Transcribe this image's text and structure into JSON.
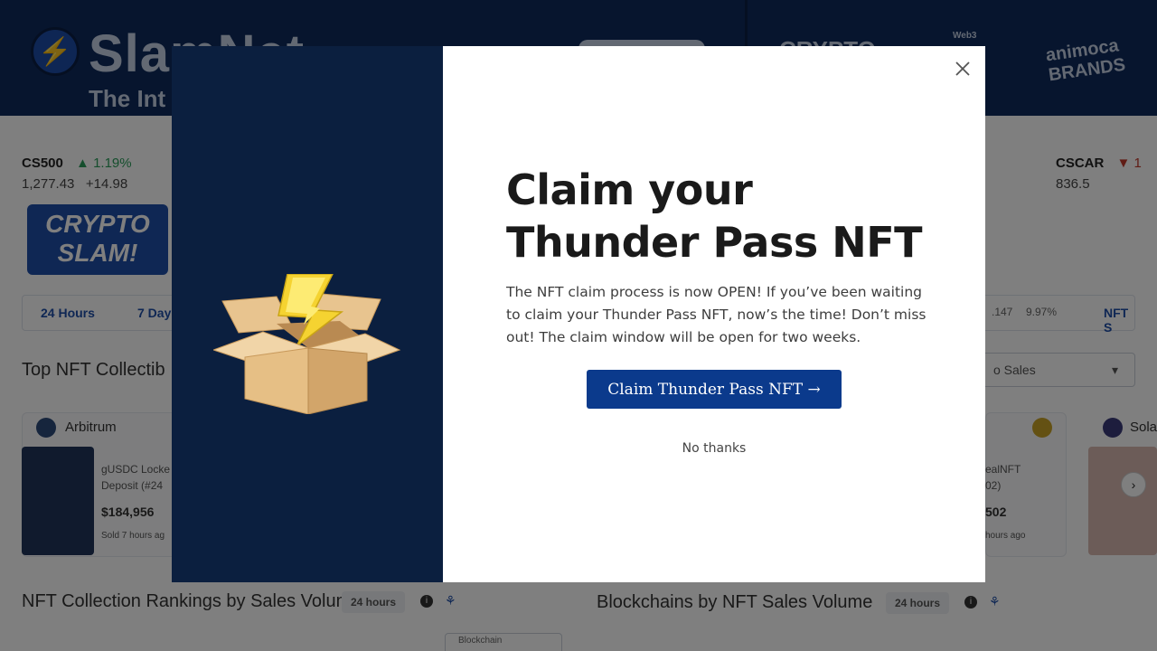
{
  "background": {
    "brand": {
      "name": "SlamNet",
      "tagline": "The Int"
    },
    "partners": [
      "CRYPTO",
      "Web3",
      "animoca BRANDS"
    ],
    "tickers": [
      {
        "symbol": "CS500",
        "change": "1.19%",
        "value": "1,277.43",
        "delta": "+14.98"
      },
      {
        "symbol": "CSCAR",
        "change": "1",
        "value": "836.5"
      }
    ],
    "badge": "CRYPTO SLAM!",
    "tabs": [
      "24 Hours",
      "7 Day"
    ],
    "tab_stats": [
      ".147",
      "9.97%",
      "NFT S"
    ],
    "section_title": "Top NFT Collectib",
    "select_label": "o Sales",
    "chains": [
      {
        "name": "Arbitrum",
        "item_text": "gUSDC Locke\nDeposit (#24",
        "price": "$184,956",
        "sold": "Sold 7 hours ag"
      },
      {
        "name": "Sola",
        "item_text": "ealNFT\n02)",
        "price": "502",
        "sold": "hours ago"
      }
    ],
    "rankings_title": "NFT Collection Rankings by Sales Volume",
    "rankings_pill": "24 hours",
    "blockchains_title": "Blockchains by NFT Sales Volume",
    "blockchains_pill": "24 hours",
    "blockchain_select": "Blockchain"
  },
  "modal": {
    "title_line1": "Claim your",
    "title_line2": "Thunder Pass NFT",
    "body": "The NFT claim process is now OPEN! If you’ve been waiting to claim your Thunder Pass NFT, now’s the time! Don’t miss out! The claim window will be open for two weeks.",
    "claim_button": "Claim Thunder Pass NFT →",
    "dismiss_link": "No thanks"
  },
  "colors": {
    "header_bg": "#0f2a5c",
    "modal_left_bg": "#0b1f3f",
    "claim_button_bg": "#0b3a8c",
    "positive": "#2a9d5a"
  }
}
